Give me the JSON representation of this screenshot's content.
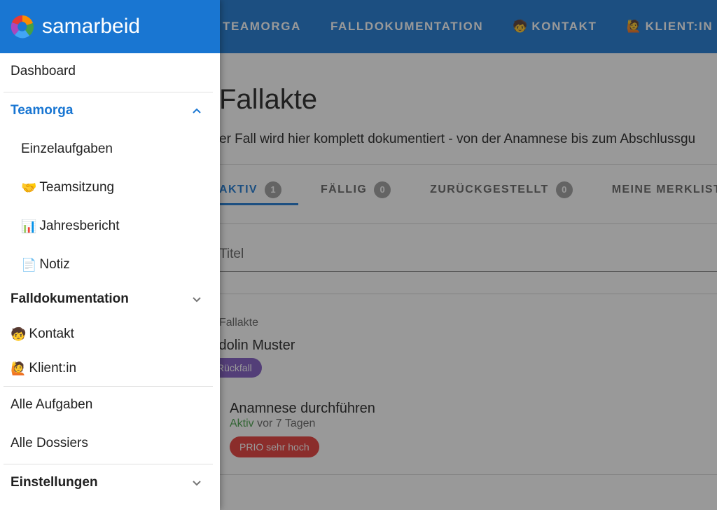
{
  "brand": {
    "name": "samarbeid",
    "logo_icon": "samarbeid-logo-icon"
  },
  "appbar": {
    "nav": [
      {
        "label": "TEAMORGA"
      },
      {
        "label": "FALLDOKUMENTATION"
      },
      {
        "emoji": "🧒",
        "label": "KONTAKT"
      },
      {
        "emoji": "🙋",
        "label": "KLIENT:IN"
      }
    ]
  },
  "drawer": {
    "dashboard": "Dashboard",
    "teamorga": "Teamorga",
    "teamorga_items": [
      {
        "emoji": "",
        "label": "Einzelaufgaben"
      },
      {
        "emoji": "🤝",
        "label": "Teamsitzung"
      },
      {
        "emoji": "📊",
        "label": "Jahresbericht"
      },
      {
        "emoji": "📄",
        "label": "Notiz"
      }
    ],
    "falldokumentation": "Falldokumentation",
    "contacts": [
      {
        "emoji": "🧒",
        "label": "Kontakt"
      },
      {
        "emoji": "🙋",
        "label": "Klient:in"
      }
    ],
    "alle_aufgaben": "Alle Aufgaben",
    "alle_dossiers": "Alle Dossiers",
    "einstellungen": "Einstellungen"
  },
  "main": {
    "title": "Fallakte",
    "subtitle": "er Fall wird hier komplett dokumentiert - von der Anamnese bis zum Abschlussgu",
    "tabs": [
      {
        "label": "AKTIV",
        "count": "1"
      },
      {
        "label": "FÄLLIG",
        "count": "0"
      },
      {
        "label": "ZURÜCKGESTELLT",
        "count": "0"
      },
      {
        "label": "MEINE MERKLIST",
        "count": ""
      }
    ],
    "search_placeholder": "Titel",
    "card": {
      "overline": "Fallakte",
      "title": "idolin Muster",
      "tag": "Rückfall",
      "task": {
        "title": "Anamnese durchführen",
        "status": "Aktiv",
        "time": "vor 7 Tagen",
        "priority": "PRIO sehr hoch"
      }
    }
  },
  "colors": {
    "primary": "#1976d2",
    "tag_purple": "#7e57c2",
    "prio_red": "#e53935",
    "status_green": "#43a047"
  }
}
